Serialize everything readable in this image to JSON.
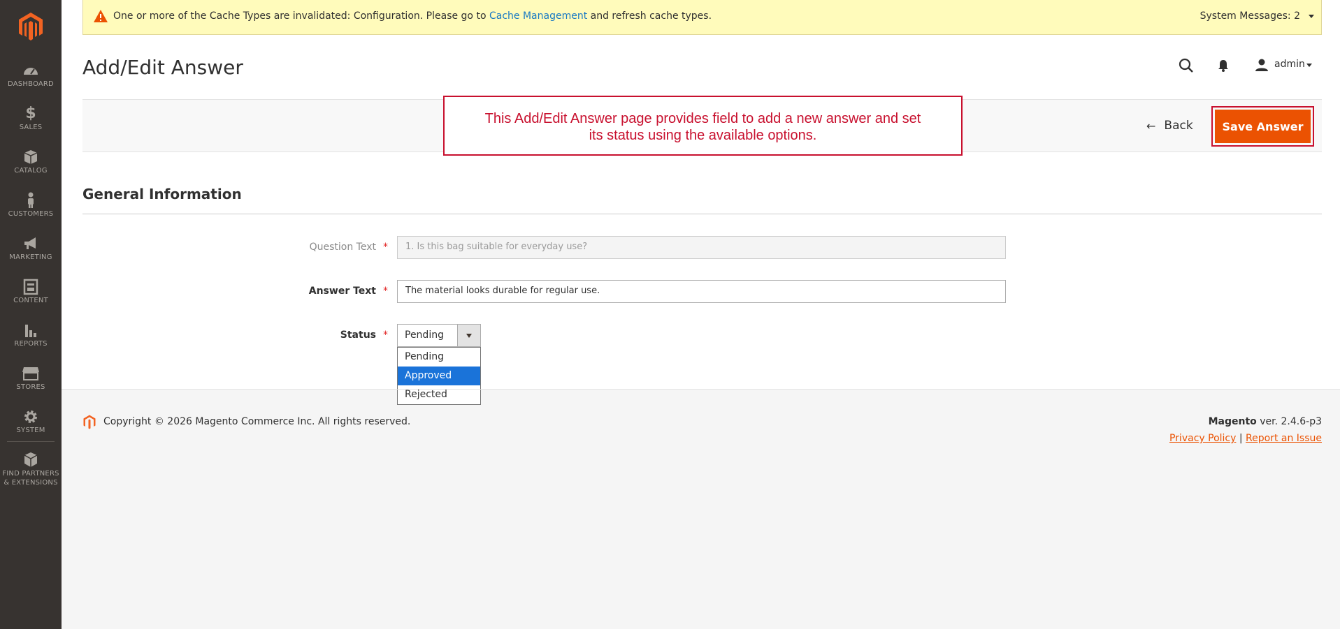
{
  "sidebar": {
    "items": [
      {
        "label": "DASHBOARD",
        "icon": "dashboard-icon"
      },
      {
        "label": "SALES",
        "icon": "dollar-icon"
      },
      {
        "label": "CATALOG",
        "icon": "box-icon"
      },
      {
        "label": "CUSTOMERS",
        "icon": "person-icon"
      },
      {
        "label": "MARKETING",
        "icon": "megaphone-icon"
      },
      {
        "label": "CONTENT",
        "icon": "layout-icon"
      },
      {
        "label": "REPORTS",
        "icon": "bar-chart-icon"
      },
      {
        "label": "STORES",
        "icon": "storefront-icon"
      },
      {
        "label": "SYSTEM",
        "icon": "gear-icon"
      },
      {
        "label_line1": "FIND PARTNERS",
        "label_line2": "& EXTENSIONS",
        "icon": "cubes-icon"
      }
    ]
  },
  "system_message": {
    "text_before": "One or more of the Cache Types are invalidated: Configuration. Please go to",
    "link": "Cache Management",
    "text_after": "and refresh cache types.",
    "count_label": "System Messages: 2"
  },
  "header": {
    "title": "Add/Edit Answer",
    "user": "admin"
  },
  "actions": {
    "back_label": "Back",
    "save_label": "Save Answer"
  },
  "callout": {
    "line1": "This Add/Edit Answer page provides field to add a new answer and set",
    "line2": "its status using the available options."
  },
  "form": {
    "section_title": "General Information",
    "question_label": "Question Text",
    "question_value": "1. Is this bag suitable for everyday use?",
    "answer_label": "Answer Text",
    "answer_value": "The material looks durable for regular use.",
    "status_label": "Status",
    "status_value": "Pending",
    "required_mark": "*",
    "status_options": [
      "Pending",
      "Approved",
      "Rejected"
    ],
    "highlighted_option": "Approved"
  },
  "footer": {
    "copyright": "Copyright © 2026 Magento Commerce Inc. All rights reserved.",
    "brand": "Magento",
    "version": "ver. 2.4.6-p3",
    "privacy": "Privacy Policy",
    "separator": "|",
    "report": "Report an Issue"
  },
  "colors": {
    "sidebar_bg": "#373330",
    "accent": "#eb5202",
    "annotation": "#c8102e",
    "link": "#1979c3",
    "highlight": "#1a73d9"
  }
}
